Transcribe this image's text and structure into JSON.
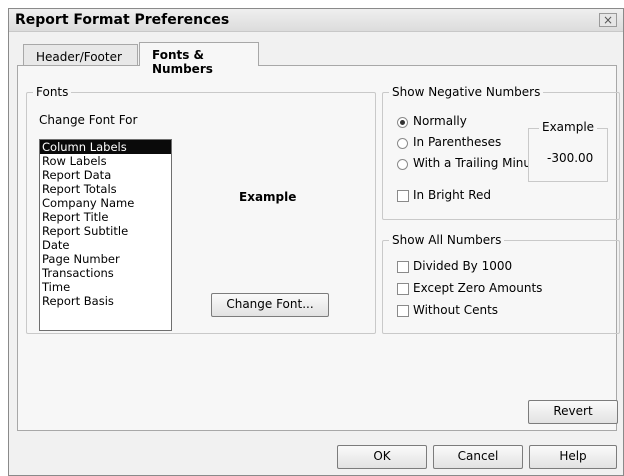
{
  "window": {
    "title": "Report Format Preferences",
    "close_glyph": "×"
  },
  "tabs": [
    {
      "label": "Header/Footer",
      "active": false
    },
    {
      "label": "Fonts & Numbers",
      "active": true
    }
  ],
  "fonts": {
    "legend": "Fonts",
    "change_font_for_label": "Change Font For",
    "items": [
      "Column Labels",
      "Row Labels",
      "Report Data",
      "Report Totals",
      "Company Name",
      "Report Title",
      "Report Subtitle",
      "Date",
      "Page Number",
      "Transactions",
      "Time",
      "Report Basis"
    ],
    "selected_index": 0,
    "example_label": "Example",
    "change_font_button": "Change Font..."
  },
  "negative_numbers": {
    "legend": "Show Negative Numbers",
    "options": [
      {
        "label": "Normally",
        "checked": true
      },
      {
        "label": "In Parentheses",
        "checked": false
      },
      {
        "label": "With a Trailing Minus",
        "checked": false
      }
    ],
    "example_legend": "Example",
    "example_value": "-300.00",
    "bright_red_label": "In Bright Red",
    "bright_red_checked": false
  },
  "all_numbers": {
    "legend": "Show All Numbers",
    "options": [
      {
        "label": "Divided By 1000",
        "checked": false
      },
      {
        "label": "Except Zero Amounts",
        "checked": false
      },
      {
        "label": "Without Cents",
        "checked": false
      }
    ]
  },
  "buttons": {
    "revert": "Revert",
    "ok": "OK",
    "cancel": "Cancel",
    "help": "Help"
  }
}
